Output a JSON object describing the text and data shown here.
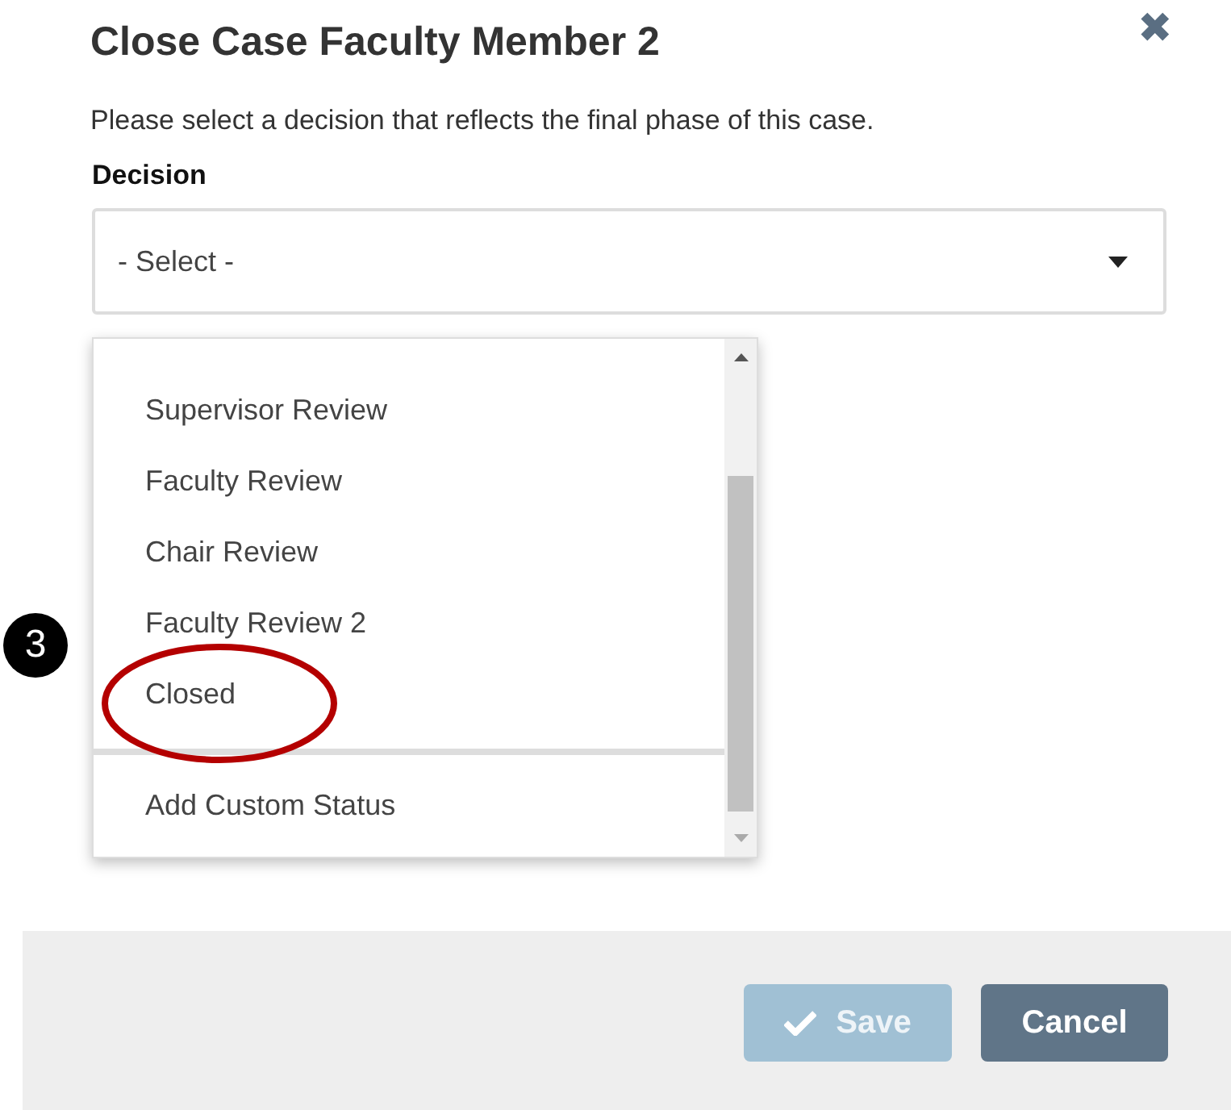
{
  "dialog": {
    "title": "Close Case Faculty Member 2",
    "close": "✖",
    "description": "Please select a decision that reflects the final phase of this case."
  },
  "decision": {
    "label": "Decision",
    "placeholder": "- Select -"
  },
  "dropdown": {
    "options": [
      {
        "label": "Supervisor Review",
        "circled": false
      },
      {
        "label": "Faculty Review",
        "circled": false
      },
      {
        "label": "Chair Review",
        "circled": false
      },
      {
        "label": "Faculty Review 2",
        "circled": false
      },
      {
        "label": "Closed",
        "circled": true
      }
    ],
    "extra_option": "Add Custom Status"
  },
  "callout": {
    "number": "3"
  },
  "buttons": [
    {
      "kind": "save",
      "label": "Save",
      "disabled": true
    },
    {
      "kind": "cancel",
      "label": "Cancel",
      "disabled": false
    }
  ]
}
